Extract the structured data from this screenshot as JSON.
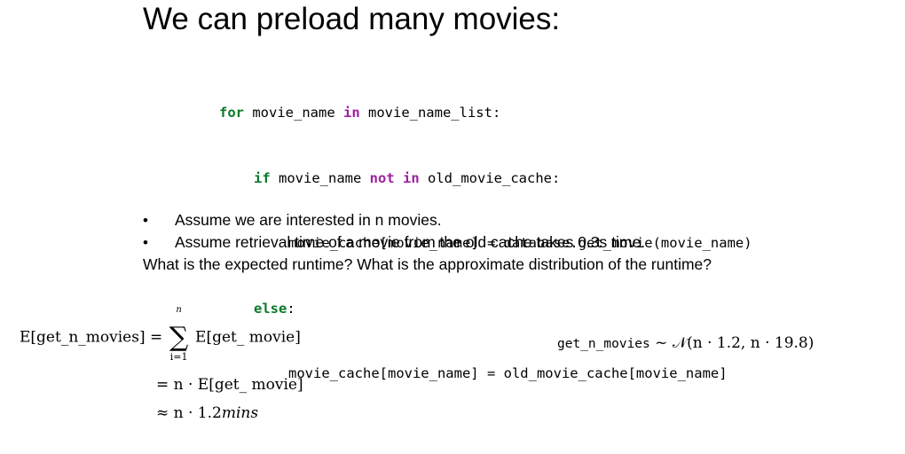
{
  "slide": {
    "title": "We can preload many movies:"
  },
  "code": {
    "line1": {
      "kw_for": "for",
      "a": " movie_name ",
      "kw_in": "in",
      "b": " movie_name_list:"
    },
    "line2": {
      "kw_if": "if",
      "a": " movie_name ",
      "kw_not": "not",
      "sp": " ",
      "kw_in": "in",
      "b": " old_movie_cache:"
    },
    "line3": {
      "text": "movie_cache[movie_name] = database.get_movie(movie_name)"
    },
    "line4": {
      "kw_else": "else",
      "b": ":"
    },
    "line5": {
      "text": "movie_cache[movie_name] = old_movie_cache[movie_name]"
    }
  },
  "bullets": [
    "Assume we are interested in n movies.",
    "Assume retrieval time of a movie from the old cache takes 0.3s time."
  ],
  "bullet_symbol": "•",
  "question": "What is the expected runtime? What is the approximate distribution of the runtime?",
  "math": {
    "lhs": "E[get_n_movies]",
    "eq1": "=",
    "sum_top": "n",
    "sum_symbol": "∑",
    "sum_bottom": "i=1",
    "term1": "E[get_ movie]",
    "line2": "= n · E[get_ movie]",
    "line3_prefix": "≈ n · 1.2",
    "line3_unit": "mins",
    "dist_lhs": "get_n_movies",
    "dist_rhs": " ~ 𝒩(n · 1.2, n · 19.8)"
  }
}
